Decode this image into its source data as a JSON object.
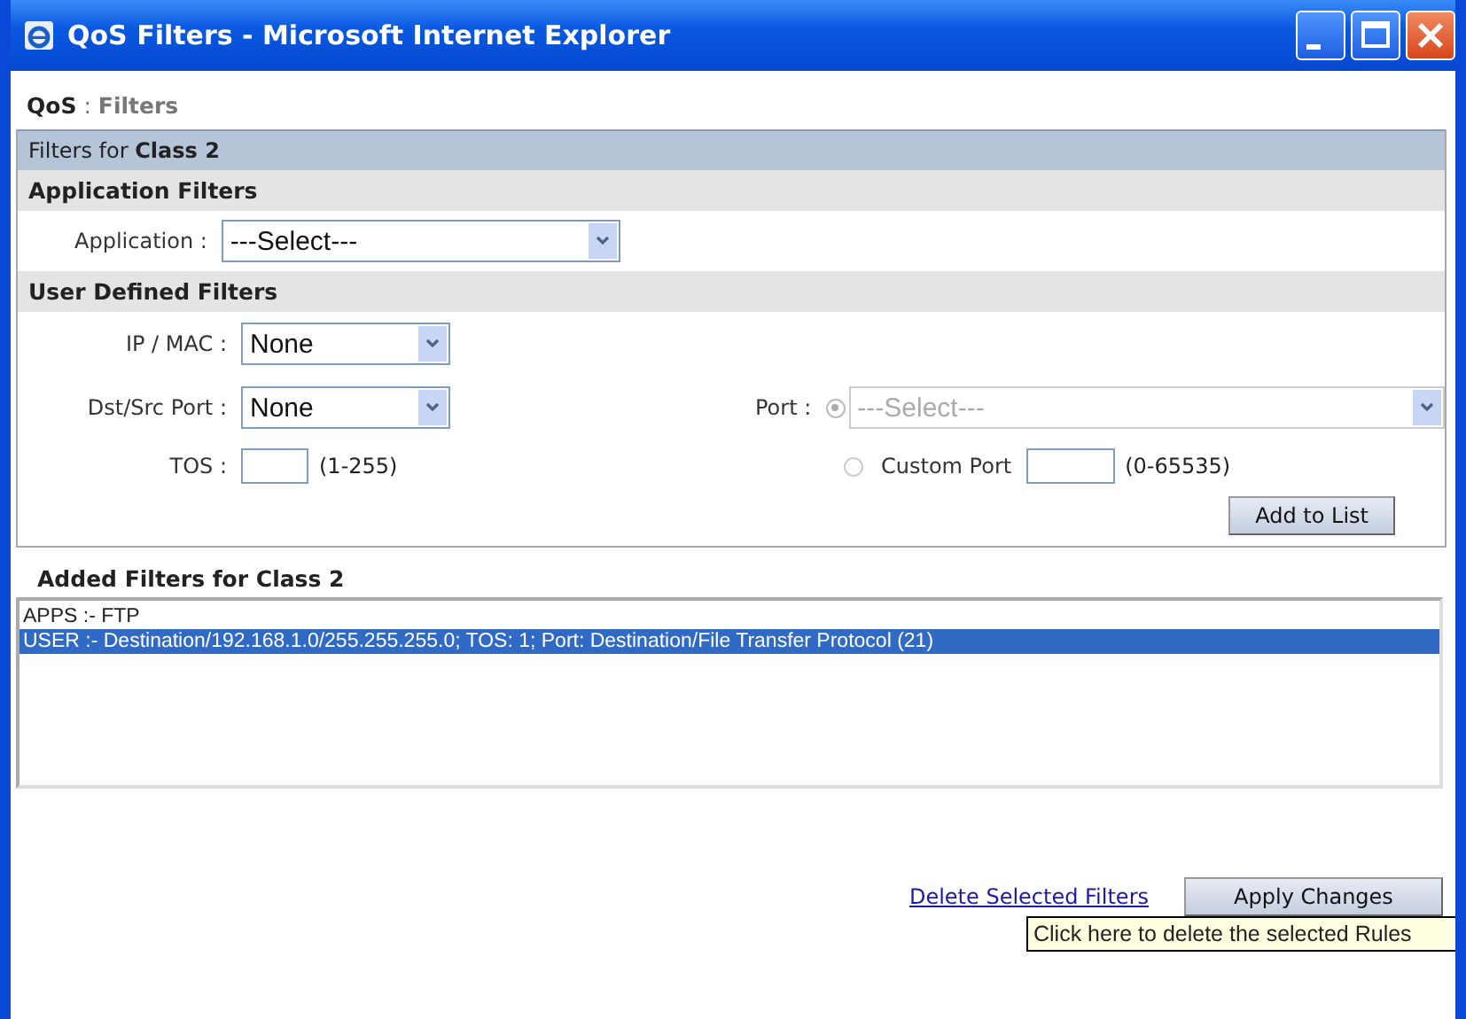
{
  "window": {
    "title": "QoS Filters - Microsoft Internet Explorer"
  },
  "breadcrumb": {
    "section": "QoS",
    "separator": ":",
    "page": "Filters"
  },
  "panel": {
    "title": "Filters for **Class 2**",
    "application_filters": {
      "heading": "Application Filters",
      "label": "Application :",
      "value": "---Select---"
    },
    "user_defined_filters": {
      "heading": "User Defined Filters",
      "ip_mac": {
        "label": "IP / MAC :",
        "value": "None"
      },
      "dst_src_port": {
        "label": "Dst/Src Port :",
        "value": "None"
      },
      "tos": {
        "label": "TOS :",
        "range": "(1-255)"
      },
      "port": {
        "label": "Port :",
        "radios": [
          {
            "kind": "select",
            "selected": true,
            "disabled": true,
            "value": "---Select---"
          },
          {
            "kind": "custom",
            "selected": false,
            "disabled": false,
            "label": "Custom Port",
            "range": "(0-65535)"
          }
        ]
      },
      "add_button": "Add to List"
    }
  },
  "added_filters": {
    "heading": "Added Filters for Class 2",
    "items": [
      {
        "text": "APPS :- FTP",
        "selected": false
      },
      {
        "text": "USER :- Destination/192.168.1.0/255.255.255.0; TOS: 1; Port: Destination/File Transfer Protocol (21)",
        "selected": true
      }
    ]
  },
  "actions": {
    "delete_link": "Delete Selected Filters",
    "apply_button": "Apply Changes"
  },
  "tooltip": "Click here to delete the selected Rules"
}
